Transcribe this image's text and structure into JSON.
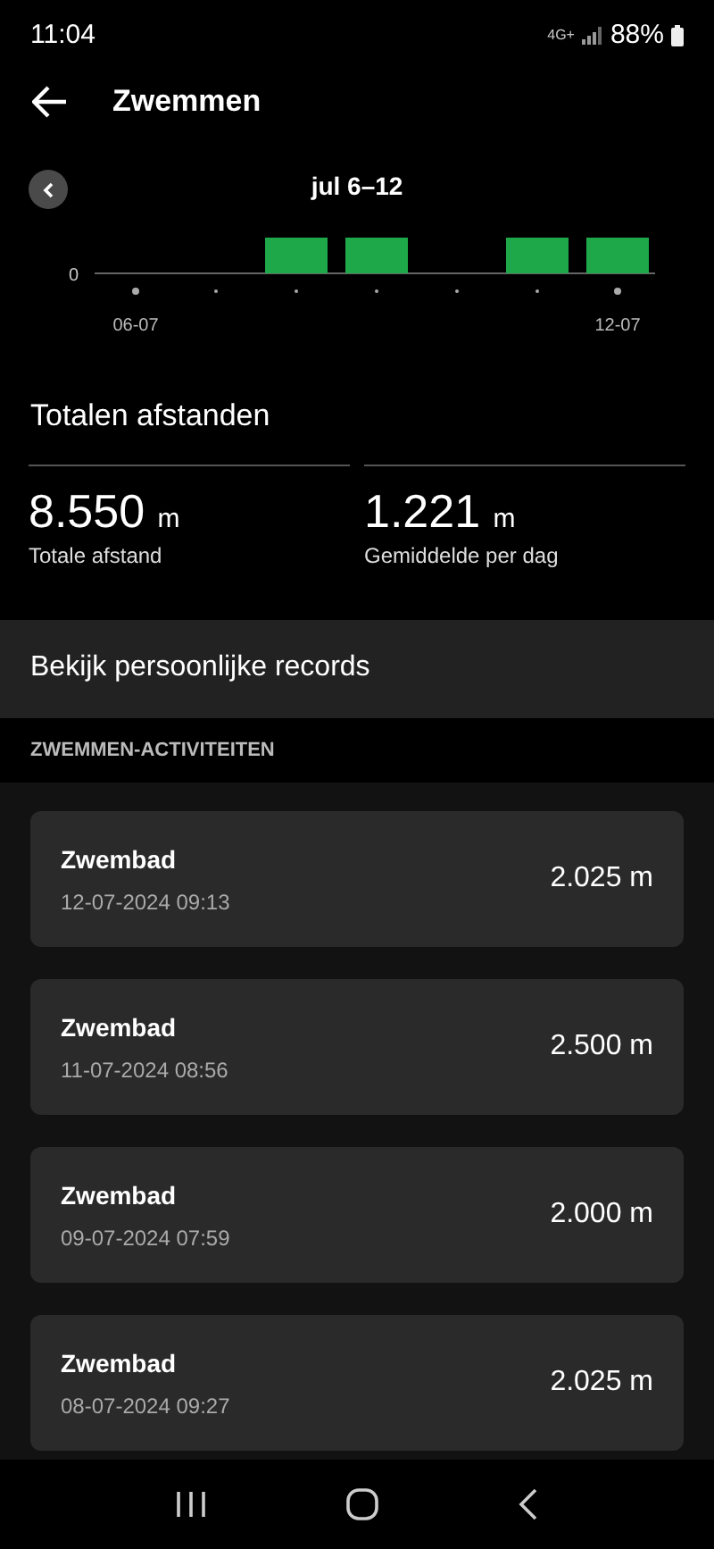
{
  "status_bar": {
    "time": "11:04",
    "network": "4G+",
    "battery": "88%"
  },
  "header": {
    "title": "Zwemmen"
  },
  "chart": {
    "title": "jul 6–12",
    "y_label": "0",
    "x_labels": [
      "06-07",
      "12-07"
    ],
    "days": [
      {
        "active": false
      },
      {
        "active": false
      },
      {
        "active": true
      },
      {
        "active": true
      },
      {
        "active": false
      },
      {
        "active": true
      },
      {
        "active": true
      }
    ]
  },
  "totals": {
    "title": "Totalen afstanden",
    "stats": [
      {
        "value": "8.550",
        "unit": "m",
        "label": "Totale afstand"
      },
      {
        "value": "1.221",
        "unit": "m",
        "label": "Gemiddelde per dag"
      }
    ]
  },
  "records_link": "Bekijk persoonlijke records",
  "activities": {
    "heading": "ZWEMMEN-ACTIVITEITEN",
    "items": [
      {
        "title": "Zwembad",
        "date": "12-07-2024 09:13",
        "distance": "2.025 m"
      },
      {
        "title": "Zwembad",
        "date": "11-07-2024 08:56",
        "distance": "2.500 m"
      },
      {
        "title": "Zwembad",
        "date": "09-07-2024 07:59",
        "distance": "2.000 m"
      },
      {
        "title": "Zwembad",
        "date": "08-07-2024 09:27",
        "distance": "2.025 m"
      }
    ]
  }
}
